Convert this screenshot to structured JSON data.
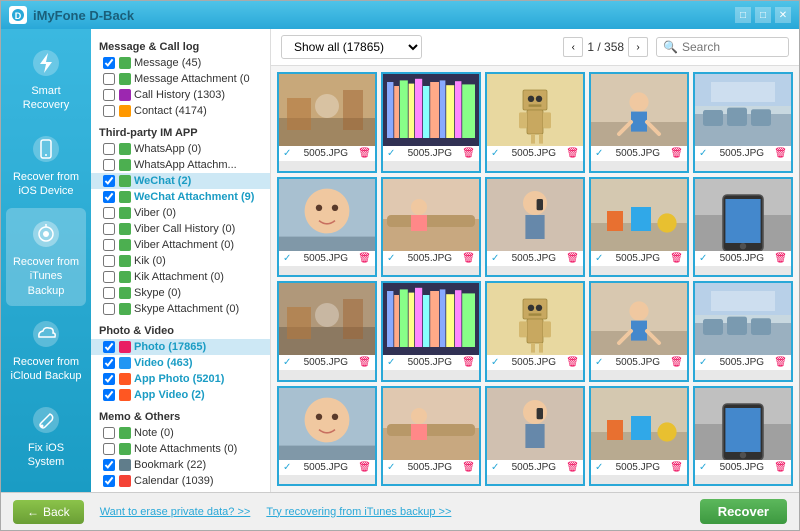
{
  "app": {
    "title": "iMyFone D-Back",
    "title_color": "#1a5f7a"
  },
  "titlebar": {
    "controls": [
      "minimize",
      "maximize",
      "close"
    ]
  },
  "sidebar": {
    "items": [
      {
        "id": "smart-recovery",
        "label": "Smart\nRecovery",
        "active": false
      },
      {
        "id": "recover-ios",
        "label": "Recover from\niOS Device",
        "active": false
      },
      {
        "id": "recover-itunes",
        "label": "Recover from\niTunes Backup",
        "active": false
      },
      {
        "id": "recover-icloud",
        "label": "Recover from\niCloud Backup",
        "active": false
      },
      {
        "id": "fix-ios",
        "label": "Fix iOS\nSystem",
        "active": false
      }
    ]
  },
  "tree": {
    "sections": [
      {
        "label": "Message & Call log",
        "items": [
          {
            "id": "message",
            "label": "Message (45)",
            "checked": true,
            "icon": "msg"
          },
          {
            "id": "message-attach",
            "label": "Message Attachment (0",
            "checked": false,
            "icon": "msg"
          },
          {
            "id": "call-history",
            "label": "Call History (1303)",
            "checked": false,
            "icon": "call"
          },
          {
            "id": "contact",
            "label": "Contact (4174)",
            "checked": false,
            "icon": "contact"
          }
        ]
      },
      {
        "label": "Third-party IM APP",
        "items": [
          {
            "id": "whatsapp",
            "label": "WhatsApp (0)",
            "checked": false,
            "icon": "wechat"
          },
          {
            "id": "whatsapp-attach",
            "label": "WhatsApp Attachm...",
            "checked": false,
            "icon": "wechat"
          },
          {
            "id": "wechat",
            "label": "WeChat (2)",
            "checked": true,
            "icon": "wechat",
            "highlight": true
          },
          {
            "id": "wechat-attach",
            "label": "WeChat Attachment (9)",
            "checked": true,
            "icon": "wechat",
            "highlight": true
          },
          {
            "id": "viber",
            "label": "Viber (0)",
            "checked": false,
            "icon": "wechat"
          },
          {
            "id": "viber-call",
            "label": "Viber Call History (0)",
            "checked": false,
            "icon": "wechat"
          },
          {
            "id": "viber-attach",
            "label": "Viber Attachment (0)",
            "checked": false,
            "icon": "wechat"
          },
          {
            "id": "kik",
            "label": "Kik (0)",
            "checked": false,
            "icon": "wechat"
          },
          {
            "id": "kik-attach",
            "label": "Kik Attachment (0)",
            "checked": false,
            "icon": "wechat"
          },
          {
            "id": "skype",
            "label": "Skype (0)",
            "checked": false,
            "icon": "wechat"
          },
          {
            "id": "skype-attach",
            "label": "Skype Attachment (0)",
            "checked": false,
            "icon": "wechat"
          }
        ]
      },
      {
        "label": "Photo & Video",
        "items": [
          {
            "id": "photo",
            "label": "Photo (17865)",
            "checked": true,
            "icon": "photo",
            "highlight": true,
            "selected": true
          },
          {
            "id": "video",
            "label": "Video (463)",
            "checked": true,
            "icon": "video",
            "highlight": true
          },
          {
            "id": "app-photo",
            "label": "App Photo (5201)",
            "checked": true,
            "icon": "app",
            "highlight": true
          },
          {
            "id": "app-video",
            "label": "App Video (2)",
            "checked": true,
            "icon": "app",
            "highlight": true
          }
        ]
      },
      {
        "label": "Memo & Others",
        "items": [
          {
            "id": "note",
            "label": "Note (0)",
            "checked": false,
            "icon": "msg"
          },
          {
            "id": "note-attach",
            "label": "Note Attachments (0)",
            "checked": false,
            "icon": "msg"
          },
          {
            "id": "bookmark",
            "label": "Bookmark (22)",
            "checked": true,
            "icon": "bookmark"
          },
          {
            "id": "calendar",
            "label": "Calendar (1039)",
            "checked": true,
            "icon": "calendar"
          }
        ]
      }
    ]
  },
  "toolbar": {
    "filter_label": "Show all (17865)",
    "page_current": 1,
    "page_total": 358,
    "search_placeholder": "Search"
  },
  "photos": {
    "filename": "5005.JPG",
    "count": 20
  },
  "bottom": {
    "back_label": "Back",
    "erase_link": "Want to erase private data? >>",
    "recover_from_link": "Try recovering from iTunes backup >>",
    "recover_label": "Recover"
  }
}
